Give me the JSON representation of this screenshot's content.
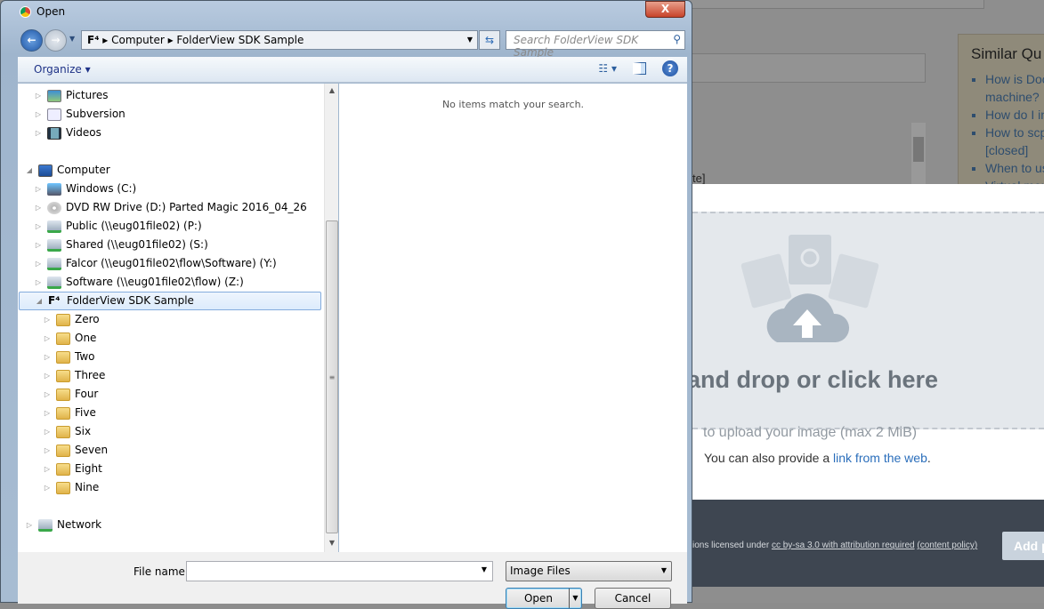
{
  "background": {
    "similar_title": "Similar Qu",
    "similar_items": [
      "How is Doc",
      "machine?",
      "How do I in",
      "How to scp",
      "[closed]",
      "When to us",
      "Virtual mem"
    ],
    "fragment": "te]",
    "drop_main": "g and drop or click here",
    "drop_sub": "to upload your image (max 2 MiB)",
    "also_prefix": "You can also provide a ",
    "also_link": "link from the web",
    "also_suffix": ".",
    "license_prefix": "ions licensed under ",
    "license_link": "cc by-sa 3.0 with attribution required",
    "policy_link": "(content policy)",
    "add_button": "Add p"
  },
  "dialog": {
    "title": "Open",
    "close": "X",
    "breadcrumb": [
      "Computer",
      "FolderView SDK Sample"
    ],
    "search_placeholder": "Search FolderView SDK Sample",
    "organize": "Organize ▾",
    "empty_message": "No items match your search.",
    "nav_items": [
      {
        "label": "Pictures",
        "icon": "pictures-icon"
      },
      {
        "label": "Subversion",
        "icon": "document-icon"
      },
      {
        "label": "Videos",
        "icon": "videos-icon"
      },
      {
        "label": "Computer",
        "icon": "computer-icon"
      },
      {
        "label": "Windows (C:)",
        "icon": "drive-icon"
      },
      {
        "label": "DVD RW Drive (D:) Parted Magic 2016_04_26",
        "icon": "dvd-icon"
      },
      {
        "label": "Public (\\\\eug01file02) (P:)",
        "icon": "network-drive-icon"
      },
      {
        "label": "Shared (\\\\eug01file02) (S:)",
        "icon": "network-drive-icon"
      },
      {
        "label": "Falcor (\\\\eug01file02\\flow\\Software) (Y:)",
        "icon": "network-drive-icon"
      },
      {
        "label": "Software (\\\\eug01file02\\flow) (Z:)",
        "icon": "network-drive-icon"
      },
      {
        "label": "FolderView SDK Sample",
        "icon": "folderview-icon"
      },
      {
        "label": "Zero",
        "icon": "folder-icon"
      },
      {
        "label": "One",
        "icon": "folder-icon"
      },
      {
        "label": "Two",
        "icon": "folder-icon"
      },
      {
        "label": "Three",
        "icon": "folder-icon"
      },
      {
        "label": "Four",
        "icon": "folder-icon"
      },
      {
        "label": "Five",
        "icon": "folder-icon"
      },
      {
        "label": "Six",
        "icon": "folder-icon"
      },
      {
        "label": "Seven",
        "icon": "folder-icon"
      },
      {
        "label": "Eight",
        "icon": "folder-icon"
      },
      {
        "label": "Nine",
        "icon": "folder-icon"
      },
      {
        "label": "Network",
        "icon": "network-icon"
      }
    ],
    "file_name_label": "File name:",
    "file_name_value": "",
    "file_type": "Image Files",
    "open": "Open",
    "cancel": "Cancel"
  }
}
